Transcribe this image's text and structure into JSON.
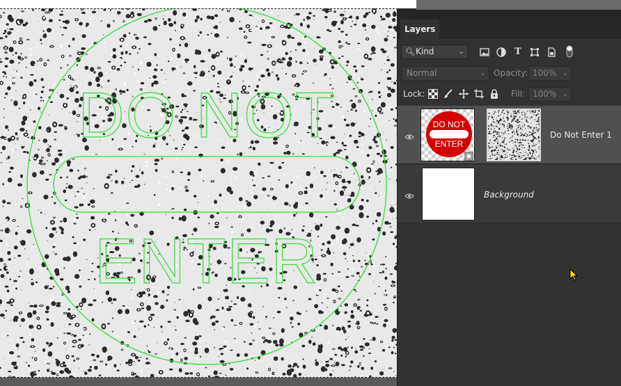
{
  "canvas": {
    "sign_text_top": "DO NOT",
    "sign_text_bottom": "ENTER",
    "outline_color": "#33e03a",
    "ink_color": "#2c2c2c",
    "paper_color": "#e9e9e9"
  },
  "panel": {
    "tab_label": "Layers",
    "filter": {
      "kind_label": "Kind",
      "icons": [
        "image-filter-icon",
        "adjustment-filter-icon",
        "type-filter-icon",
        "shape-filter-icon",
        "smart-object-filter-icon",
        "filter-toggle-icon"
      ]
    },
    "blend_mode": "Normal",
    "opacity_label": "Opacity:",
    "opacity_value": "100%",
    "lock_label": "Lock:",
    "fill_label": "Fill:",
    "fill_value": "100%",
    "layers": [
      {
        "name": "Do Not Enter 1",
        "thumb_text_top": "DO NOT",
        "thumb_text_bottom": "ENTER",
        "selected": true
      },
      {
        "name": "Background",
        "italic": true,
        "selected": false
      }
    ]
  }
}
